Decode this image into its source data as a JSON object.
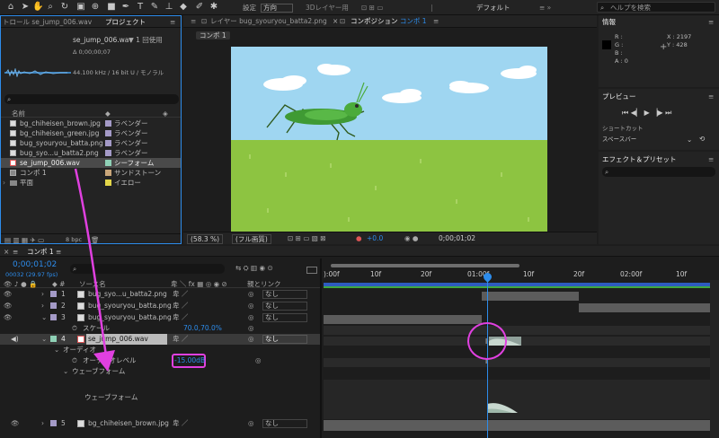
{
  "toolbar": {
    "settings_label": "設定",
    "settings_value": "方向",
    "layer3d": "3Dレイヤー用",
    "workspace": "デフォルト",
    "search_placeholder": "ヘルプを検索"
  },
  "project_panel": {
    "tab_control": "トロール se_jump_006.wav",
    "tab_project": "プロジェクト",
    "file_title": "se_jump_006.wav",
    "usage": "▼ 1 回使用",
    "duration": "Δ 0;00;00;07",
    "audio_info": "44.100 kHz / 16 bit U / モノラル",
    "search_placeholder": "",
    "col_name": "名前",
    "items": [
      {
        "name": "bg_chiheisen_brown.jpg",
        "label": "ラベンダー",
        "color": "#a49ac7"
      },
      {
        "name": "bg_chiheisen_green.jpg",
        "label": "ラベンダー",
        "color": "#a49ac7"
      },
      {
        "name": "bug_syouryou_batta.png",
        "label": "ラベンダー",
        "color": "#a49ac7"
      },
      {
        "name": "bug_syo...u_batta2.png",
        "label": "ラベンダー",
        "color": "#a49ac7"
      },
      {
        "name": "se_jump_006.wav",
        "label": "シーフォーム",
        "color": "#8fd1b6"
      },
      {
        "name": "コンポ 1",
        "label": "サンドストーン",
        "color": "#c9a67a"
      },
      {
        "name": "平面",
        "label": "イエロー",
        "color": "#e3d649"
      }
    ],
    "bpc": "8 bpc"
  },
  "viewer": {
    "tab_layer_prefix": "レイヤー",
    "tab_layer": "bug_syouryou_batta2.png",
    "tab_comp_prefix": "コンポジション",
    "tab_comp": "コンポ 1",
    "breadcrumb": "コンポ 1",
    "zoom": "(58.3 %)",
    "quality": "(フル画質)",
    "exposure": "+0.0",
    "timecode": "0;00;01;02"
  },
  "info": {
    "title": "情報",
    "r": "R :",
    "g": "G :",
    "b": "B :",
    "a": "A : 0",
    "x": "X : 2197",
    "y": "Y : 428"
  },
  "preview": {
    "title": "プレビュー",
    "shortcut_label": "ショートカット",
    "shortcut_value": "スペースバー"
  },
  "effects": {
    "title": "エフェクト＆プリセット"
  },
  "timeline": {
    "tab": "コンポ 1",
    "timecode": "0;00;01;02",
    "frames": "00032 (29.97 fps)",
    "col_source": "ソース名",
    "col_parent": "親とリンク",
    "bpc": "8 bpc",
    "ruler": [
      "):00f",
      "10f",
      "20f",
      "01:00f",
      "10f",
      "20f",
      "02:00f",
      "10f"
    ],
    "layers": [
      {
        "num": "1",
        "name": "bug_syo...u_batta2.png",
        "parent": "なし"
      },
      {
        "num": "2",
        "name": "bug_syouryou_batta.png",
        "parent": "なし"
      },
      {
        "num": "3",
        "name": "bug_syouryou_batta.png",
        "parent": "なし"
      }
    ],
    "scale_label": "スケール",
    "scale_value": "70.0,70.0%",
    "layer4": {
      "num": "4",
      "name": "se_jump_006.wav",
      "parent": "なし"
    },
    "audio_label": "オーディオ",
    "audio_level_label": "オーディオレベル",
    "audio_level_value": "-15.00dB",
    "waveform_label": "ウェーブフォーム",
    "waveform_sub": "ウェーブフォーム",
    "layer5": {
      "num": "5",
      "name": "bg_chiheisen_brown.jpg",
      "parent": "なし"
    }
  },
  "colors": {
    "accent": "#2d8ceb",
    "highlight": "#e040e0",
    "sky": "#9fd6f1",
    "grass": "#8dc441"
  }
}
